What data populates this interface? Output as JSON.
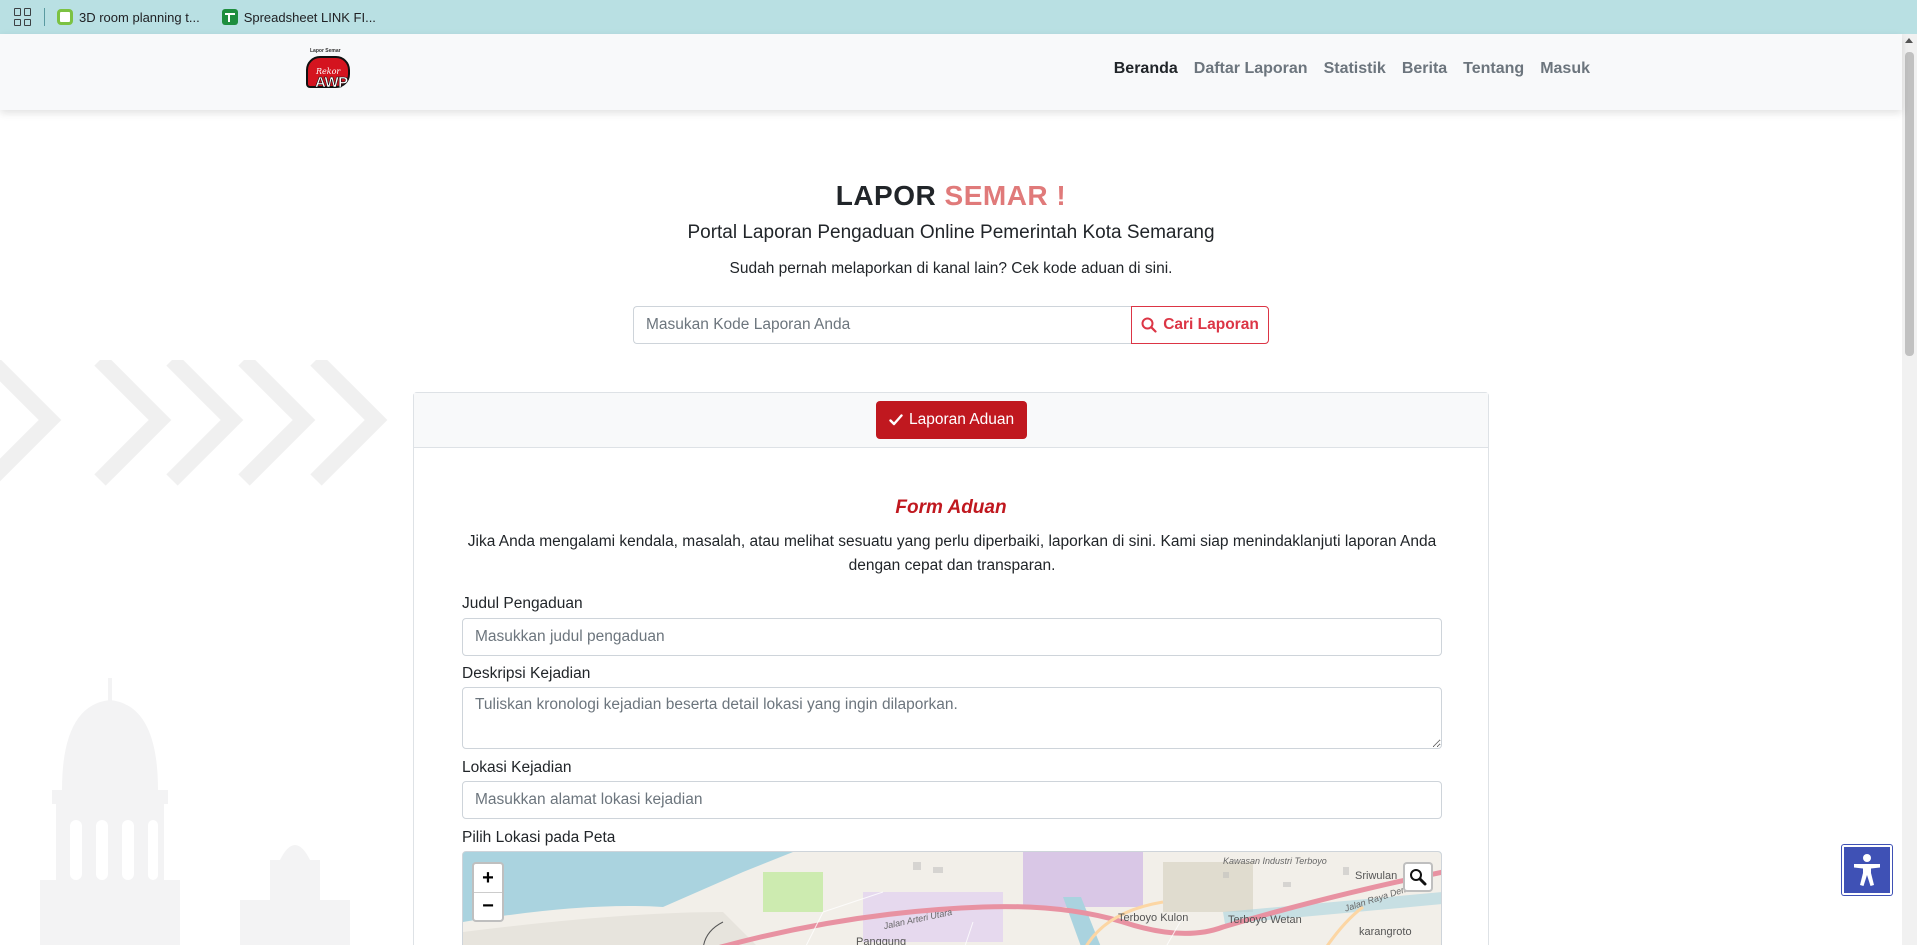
{
  "bookmarks": {
    "items": [
      {
        "label": "3D room planning t..."
      },
      {
        "label": "Spreadsheet LINK FI..."
      }
    ]
  },
  "navbar": {
    "logo": {
      "top_text": "Lapor Semar",
      "script_text": "Rekor",
      "main_text": "AWP"
    },
    "links": [
      {
        "label": "Beranda"
      },
      {
        "label": "Daftar Laporan"
      },
      {
        "label": "Statistik"
      },
      {
        "label": "Berita"
      },
      {
        "label": "Tentang"
      },
      {
        "label": "Masuk"
      }
    ]
  },
  "hero": {
    "title_part1": "LAPOR",
    "title_part2": "SEMAR !",
    "subtitle": "Portal Laporan Pengaduan Online Pemerintah Kota Semarang",
    "note": "Sudah pernah melaporkan di kanal lain? Cek kode aduan di sini.",
    "search_placeholder": "Masukan Kode Laporan Anda",
    "search_button": "Cari Laporan"
  },
  "card": {
    "tab_label": "Laporan Aduan",
    "form_title": "Form Aduan",
    "form_description": "Jika Anda mengalami kendala, masalah, atau melihat sesuatu yang perlu diperbaiki, laporkan di sini. Kami siap menindaklanjuti laporan Anda dengan cepat dan transparan.",
    "fields": {
      "judul": {
        "label": "Judul Pengaduan",
        "placeholder": "Masukkan judul pengaduan"
      },
      "deskripsi": {
        "label": "Deskripsi Kejadian",
        "placeholder": "Tuliskan kronologi kejadian beserta detail lokasi yang ingin dilaporkan."
      },
      "lokasi": {
        "label": "Lokasi Kejadian",
        "placeholder": "Masukkan alamat lokasi kejadian"
      },
      "peta": {
        "label": "Pilih Lokasi pada Peta"
      }
    },
    "map": {
      "zoom_in": "+",
      "zoom_out": "−",
      "labels": {
        "kawasan": "Kawasan Industri Terboyo",
        "sriwulan": "Sriwulan",
        "terboyo_kulon": "Terboyo Kulon",
        "terboyo_wetan": "Terboyo Wetan",
        "karangroto": "karangroto",
        "panggung": "Panggung",
        "jalan_arteri": "Jalan Arteri Utara",
        "jalan_raya": "Jalan Raya Demak"
      }
    }
  },
  "colors": {
    "accent_red": "#c0181f",
    "title_pink": "#e07a7a",
    "outline_red": "#dc3545",
    "bookmark_bar": "#b9e0e3",
    "accessibility_blue": "#3f51b5"
  }
}
